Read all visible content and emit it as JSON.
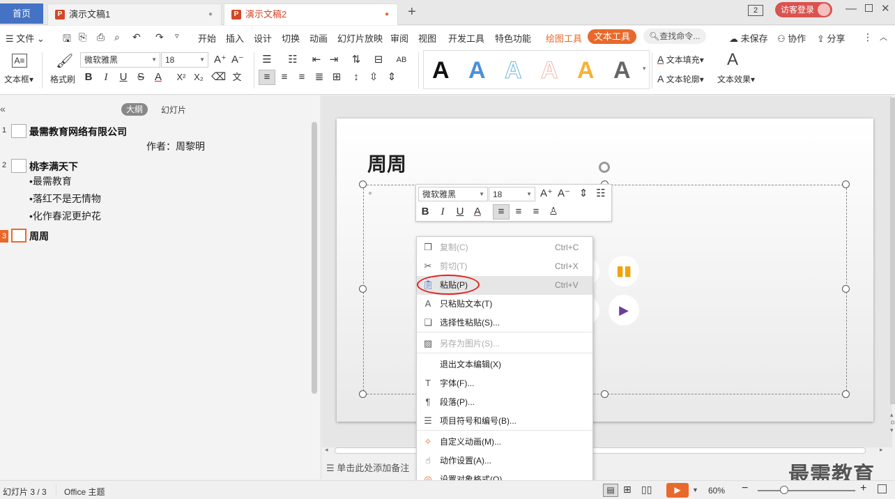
{
  "titlebar": {
    "home_tab": "首页",
    "tabs": [
      {
        "label": "演示文稿1",
        "icon": "P"
      },
      {
        "label": "演示文稿2",
        "icon": "P"
      }
    ],
    "new_tab": "+",
    "page_badge": "2",
    "login": "访客登录"
  },
  "menubar": {
    "file": "文件",
    "items": [
      "开始",
      "插入",
      "设计",
      "切换",
      "动画",
      "幻灯片放映",
      "审阅",
      "视图",
      "开发工具",
      "特色功能"
    ],
    "drawing_tools": "绘图工具",
    "text_tools": "文本工具",
    "search": "查找命令...",
    "unsaved": "未保存",
    "collab": "协作",
    "share": "分享"
  },
  "toolbar": {
    "textbox": "文本框",
    "format_painter": "格式刷",
    "font": "微软雅黑",
    "size": "18",
    "text_fill": "文本填充",
    "text_outline": "文本轮廓",
    "text_effect": "文本效果",
    "art_styles": [
      {
        "glyph": "A",
        "color": "#111111"
      },
      {
        "glyph": "A",
        "color": "#4a90d9"
      },
      {
        "glyph": "A",
        "color": "#69b4e0"
      },
      {
        "glyph": "A",
        "color": "#f2b6a8"
      },
      {
        "glyph": "A",
        "color": "#f5b335"
      },
      {
        "glyph": "A",
        "color": "#666666"
      }
    ]
  },
  "leftpanel": {
    "collapse": "«",
    "outline_tab": "大纲",
    "slides_tab": "幻灯片",
    "slides": [
      {
        "num": "1",
        "title": "最需教育网络有限公司",
        "subs": [
          "作者：周黎明"
        ]
      },
      {
        "num": "2",
        "title": "桃李满天下",
        "subs": [
          "•最需教育",
          "•落红不是无情物",
          "•化作春泥更护花"
        ]
      },
      {
        "num": "3",
        "title": "周周",
        "subs": []
      }
    ]
  },
  "slide": {
    "title": "周周"
  },
  "minibar": {
    "font": "微软雅黑",
    "size": "18"
  },
  "contextmenu": {
    "items": [
      {
        "label": "复制(C)",
        "shortcut": "Ctrl+C",
        "icon": "copy-icon",
        "disabled": true
      },
      {
        "label": "剪切(T)",
        "shortcut": "Ctrl+X",
        "icon": "cut-icon",
        "disabled": true
      },
      {
        "label": "粘贴(P)",
        "shortcut": "Ctrl+V",
        "icon": "paste-icon",
        "disabled": false
      },
      {
        "label": "只粘贴文本(T)",
        "shortcut": "",
        "icon": "paste-text-icon",
        "disabled": false
      },
      {
        "label": "选择性粘贴(S)...",
        "shortcut": "",
        "icon": "paste-special-icon",
        "disabled": false
      },
      {
        "label": "另存为图片(S)...",
        "shortcut": "",
        "icon": "save-image-icon",
        "disabled": true
      },
      {
        "label": "退出文本编辑(X)",
        "shortcut": "",
        "icon": "",
        "disabled": false
      },
      {
        "label": "字体(F)...",
        "shortcut": "",
        "icon": "font-icon",
        "disabled": false
      },
      {
        "label": "段落(P)...",
        "shortcut": "",
        "icon": "paragraph-icon",
        "disabled": false
      },
      {
        "label": "项目符号和编号(B)...",
        "shortcut": "",
        "icon": "bullets-icon",
        "disabled": false
      },
      {
        "label": "自定义动画(M)...",
        "shortcut": "",
        "icon": "animation-icon",
        "disabled": false
      },
      {
        "label": "动作设置(A)...",
        "shortcut": "",
        "icon": "action-icon",
        "disabled": false
      },
      {
        "label": "设置对象格式(O)...",
        "shortcut": "",
        "icon": "format-object-icon",
        "disabled": false
      }
    ]
  },
  "notes": {
    "placeholder": "单击此处添加备注"
  },
  "statusbar": {
    "slide_info": "幻灯片 3 / 3",
    "theme": "Office 主题",
    "zoom": "60%"
  },
  "watermark": "最需教育",
  "colors": {
    "accent_orange": "#e8692b",
    "home_blue": "#4472c4",
    "highlight_red": "#e02020"
  }
}
